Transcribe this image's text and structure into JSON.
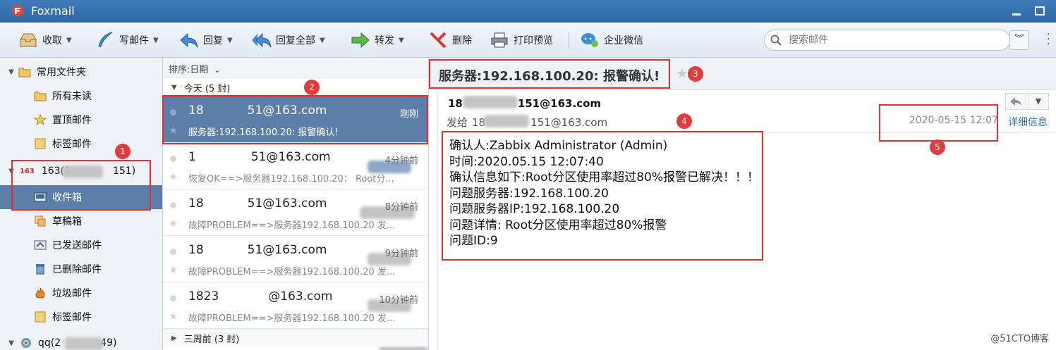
{
  "app": {
    "title": "Foxmail"
  },
  "toolbar": {
    "receive": "收取",
    "compose": "写邮件",
    "reply": "回复",
    "reply_all": "回复全部",
    "forward": "转发",
    "delete": "删除",
    "print_preview": "打印预览",
    "wecom": "企业微信"
  },
  "search": {
    "placeholder": "搜索邮件"
  },
  "sidebar": {
    "favorites": "常用文件夹",
    "all_unread": "所有未读",
    "pinned": "置顶邮件",
    "tagged": "标签邮件",
    "account_badge": "163",
    "account_name": "163(1",
    "account_suffix": "151)",
    "inbox": "收件箱",
    "drafts": "草稿箱",
    "sent": "已发送邮件",
    "deleted": "已删除邮件",
    "junk": "垃圾邮件",
    "tagged2": "标签邮件",
    "qq_prefix": "qq(2",
    "qq_suffix": "49)"
  },
  "list": {
    "sort": "排序:日期",
    "group_today": "今天 (5 封)",
    "group_3weeks": "三周前 (3 封)",
    "messages": [
      {
        "sender_a": "18",
        "sender_b": "51@163.com",
        "time": "刚刚",
        "subject": "服务器:192.168.100.20: 报警确认!"
      },
      {
        "sender_a": "1",
        "sender_b": "51@163.com",
        "time": "4分钟前",
        "subject": "恢复OK==>服务器192.168.100.20： Root分..."
      },
      {
        "sender_a": "18",
        "sender_b": "51@163.com",
        "time": "8分钟前",
        "subject": "故障PROBLEM==>服务器192.168.100.20 发..."
      },
      {
        "sender_a": "18",
        "sender_b": "51@163.com",
        "time": "9分钟前",
        "subject": "故障PROBLEM==>服务器192.168.100.20 发..."
      },
      {
        "sender_a": "1823",
        "sender_b": "@163.com",
        "time": "10分钟前",
        "subject": "故障PROBLEM==>服务器192.168.100.20 发..."
      }
    ]
  },
  "reader": {
    "subject": "服务器:192.168.100.20: 报警确认!",
    "from_a": "18",
    "from_b": "151@163.com",
    "to_label": "发给",
    "to_a": "18",
    "to_b": "151@163.com",
    "date": "2020-05-15 12:07",
    "details": "详细信息",
    "body": [
      "确认人:Zabbix Administrator (Admin)",
      "时间:2020.05.15 12:07:40",
      "确认信息如下:Root分区使用率超过80%报警已解决！！！",
      "问题服务器:192.168.100.20",
      "问题服务器IP:192.168.100.20",
      "问题详情: Root分区使用率超过80%报警",
      "问题ID:9"
    ]
  },
  "annotations": [
    "1",
    "2",
    "3",
    "4",
    "5"
  ],
  "watermark": "@51CTO博客",
  "colors": {
    "titlebar": "#3372b1",
    "selection": "#5c7ea9",
    "annotation": "#e03030",
    "link": "#2b6db8"
  }
}
